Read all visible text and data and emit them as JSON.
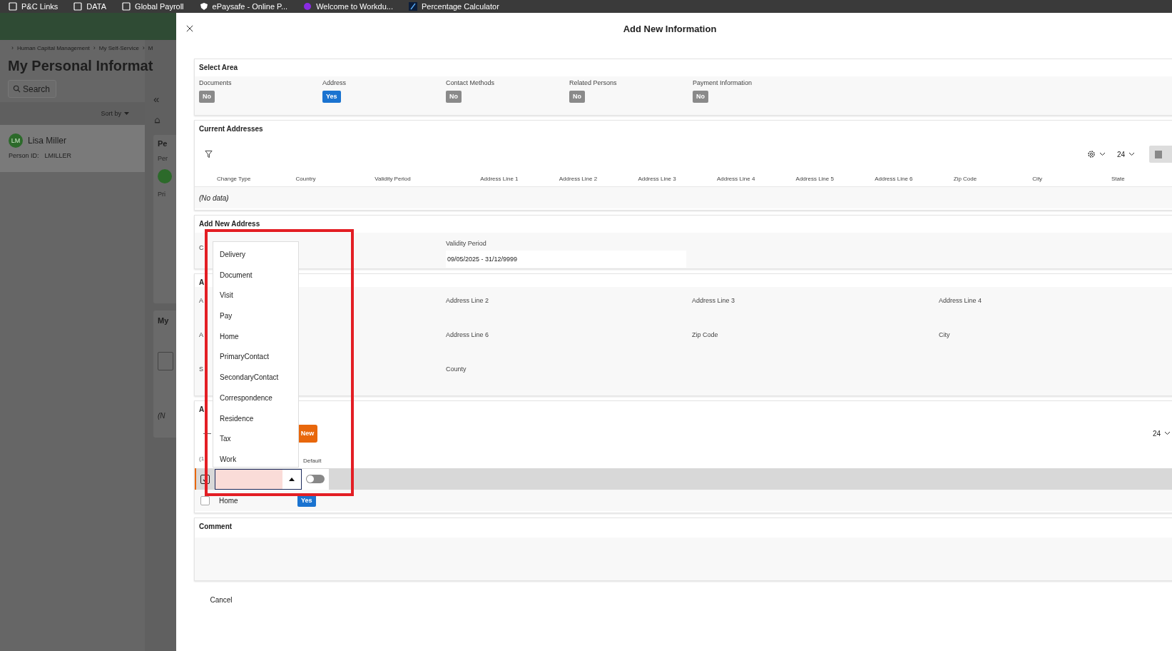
{
  "bookmarks": [
    {
      "label": "P&C Links",
      "kind": "folder"
    },
    {
      "label": "DATA",
      "kind": "folder"
    },
    {
      "label": "Global Payroll",
      "kind": "folder"
    },
    {
      "label": "ePaysafe - Online P...",
      "kind": "shield"
    },
    {
      "label": "Welcome to Workdu...",
      "kind": "circle"
    },
    {
      "label": "Percentage Calculator",
      "kind": "percent"
    }
  ],
  "background_page": {
    "breadcrumb": [
      {
        "sep": "›",
        "label": "Human Capital Management"
      },
      {
        "sep": "›",
        "label": "My Self-Service"
      },
      {
        "sep": "›",
        "label": "M"
      }
    ],
    "title": "My Personal Informat",
    "search": "Search",
    "sort_by": "Sort by",
    "person": {
      "initials": "LM",
      "name": "Lisa Miller",
      "id_label": "Person ID:",
      "id": "LMILLER"
    },
    "side_panel": {
      "collapse": "«",
      "card_title": "Pe",
      "card_label": "Per",
      "card_text": "Pri",
      "second_title": "My",
      "second_text": "(N"
    }
  },
  "dialog": {
    "title": "Add New Information",
    "select_area": {
      "title": "Select Area",
      "options": [
        {
          "label": "Documents",
          "value": "No",
          "on": false
        },
        {
          "label": "Address",
          "value": "Yes",
          "on": true
        },
        {
          "label": "Contact Methods",
          "value": "No",
          "on": false
        },
        {
          "label": "Related Persons",
          "value": "No",
          "on": false
        },
        {
          "label": "Payment Information",
          "value": "No",
          "on": false
        }
      ]
    },
    "current_addresses": {
      "title": "Current Addresses",
      "page_size": "24",
      "columns": [
        "Change Type",
        "Country",
        "Validity Period",
        "Address Line 1",
        "Address Line 2",
        "Address Line 3",
        "Address Line 4",
        "Address Line 5",
        "Address Line 6",
        "Zip Code",
        "City",
        "State"
      ],
      "empty": "(No data)"
    },
    "add_new_address": {
      "title": "Add New Address",
      "country_label": "C",
      "validity_label": "Validity Period",
      "validity_value": "09/05/2025 - 31/12/9999"
    },
    "address_fields": {
      "title": "A",
      "fields": [
        "A",
        "Address Line 2",
        "Address Line 3",
        "Address Line 4",
        "A",
        "Address Line 6",
        "Zip Code",
        "City",
        "S",
        "County"
      ]
    },
    "change_types": {
      "title": "A",
      "new_button": "New",
      "page_size": "24",
      "columns": [
        "(1",
        "Default"
      ],
      "rows": [
        {
          "kind": "edit",
          "selected": true,
          "checked": true,
          "default": false
        },
        {
          "kind": "display",
          "selected": false,
          "checked": false,
          "value": "Home",
          "default": true,
          "default_label": "Yes"
        }
      ]
    },
    "dropdown": {
      "options": [
        "Delivery",
        "Document",
        "Visit",
        "Pay",
        "Home",
        "PrimaryContact",
        "SecondaryContact",
        "Correspondence",
        "Residence",
        "Tax",
        "Work"
      ]
    },
    "comment": {
      "title": "Comment"
    },
    "cancel": "Cancel"
  }
}
